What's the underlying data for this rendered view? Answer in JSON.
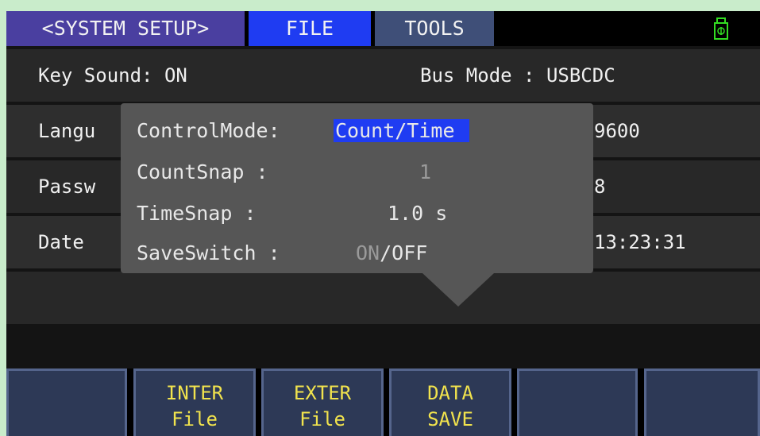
{
  "menu": {
    "tabs": [
      {
        "label": "<SYSTEM SETUP>"
      },
      {
        "label": "FILE"
      },
      {
        "label": "TOOLS"
      }
    ],
    "status_icon": "usb-icon",
    "colors": {
      "active_tab": "#1f3cf2",
      "system_tab": "#4a3fa0",
      "tools_tab": "#3f4f78",
      "usb_icon": "#33dd22"
    }
  },
  "settings": {
    "key_sound": "Key Sound: ON",
    "bus_mode": "Bus Mode : USBCDC",
    "language_partial": "Langu",
    "baud_partial": "9600",
    "password_partial": "Passw",
    "data_bits_partial": "8",
    "date_partial": "Date",
    "time_partial": "13:23:31"
  },
  "popup": {
    "control_mode_label": "ControlMode:",
    "control_mode_value": "Count/Time",
    "count_snap_label": "CountSnap  :",
    "count_snap_value": "1",
    "time_snap_label": "TimeSnap   :",
    "time_snap_value": "1.0 s",
    "save_switch_label": "SaveSwitch :",
    "save_switch_on": "ON",
    "save_switch_sep": "/",
    "save_switch_off": "OFF"
  },
  "softkeys": [
    {
      "line1": "",
      "line2": ""
    },
    {
      "line1": "INTER",
      "line2": "File"
    },
    {
      "line1": "EXTER",
      "line2": "File"
    },
    {
      "line1": "DATA",
      "line2": "SAVE"
    },
    {
      "line1": "",
      "line2": ""
    },
    {
      "line1": "",
      "line2": ""
    }
  ]
}
